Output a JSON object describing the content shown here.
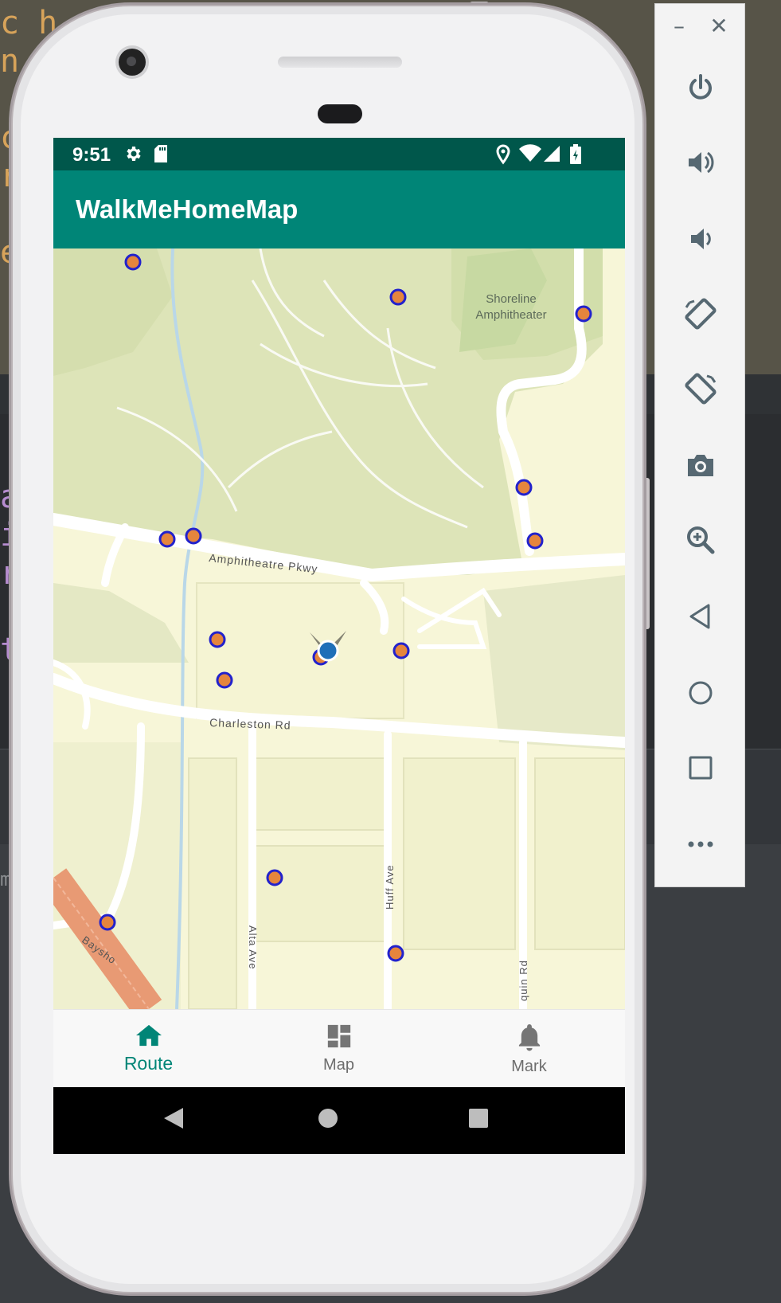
{
  "ide": {
    "code_top": "c h        d(M  nE\nn          r  ne\n\nc           T  at\nr\n            u   ;\ne           c",
    "code_mid": "a           .  es\ni              ga\nr           s  r(\n\nt",
    "code_bottom": "m"
  },
  "phone": {
    "status_bar": {
      "time": "9:51",
      "left_icons": [
        "settings-icon",
        "sd-card-icon"
      ],
      "right_icons": [
        "location-icon",
        "wifi-icon",
        "signal-icon",
        "battery-icon"
      ]
    },
    "app_bar": {
      "title": "WalkMeHomeMap"
    },
    "map": {
      "labels": {
        "amphitheater": "Shoreline\nAmphitheater",
        "amphitheatre_pkwy": "Amphitheatre Pkwy",
        "charleston_rd": "Charleston Rd",
        "huff_ave": "Huff Ave",
        "alta_ave": "Alta Ave",
        "joaquin_rd": "quin Rd",
        "bayshore": "Baysho"
      },
      "marker_colors": {
        "fill": "#e5853d",
        "stroke": "#2222cc"
      },
      "marker_count": 16
    },
    "bottom_nav": {
      "items": [
        {
          "label": "Route",
          "icon": "home-icon",
          "active": true
        },
        {
          "label": "Map",
          "icon": "dashboard-icon",
          "active": false
        },
        {
          "label": "Mark",
          "icon": "bell-icon",
          "active": false
        }
      ]
    },
    "system_nav": [
      "back-icon",
      "home-circle-icon",
      "recents-icon"
    ]
  },
  "emulator_toolbar": {
    "minimize": "–",
    "close": "✕",
    "buttons": [
      "power-icon",
      "volume-up-icon",
      "volume-down-icon",
      "rotate-left-icon",
      "rotate-right-icon",
      "camera-icon",
      "zoom-icon",
      "back-icon",
      "home-icon",
      "overview-icon",
      "more-icon"
    ]
  },
  "colors": {
    "status_bar": "#00574b",
    "app_bar": "#008577",
    "accent": "#008577",
    "map_park": "#dde4b8",
    "map_land": "#f7f6d8"
  }
}
